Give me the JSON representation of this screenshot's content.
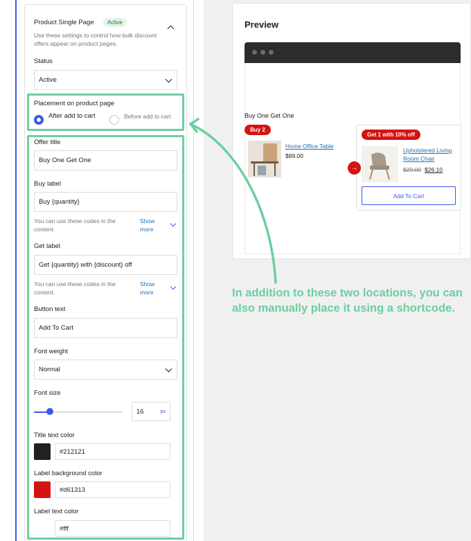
{
  "settings": {
    "section_title": "Product Single Page",
    "section_badge": "Active",
    "section_description": "Use these settings to control how bulk discount offers appear on product pages.",
    "status": {
      "label": "Status",
      "value": "Active"
    },
    "placement": {
      "label": "Placement on product page",
      "options": [
        {
          "label": "After add to cart",
          "selected": true
        },
        {
          "label": "Before add to cart",
          "selected": false
        }
      ]
    },
    "offer_title": {
      "label": "Offer title",
      "value": "Buy One Get One"
    },
    "buy_label": {
      "label": "Buy label",
      "value": "Buy {quantity}"
    },
    "buy_help": "You can use these codes in the content.",
    "show_more": "Show more",
    "get_label": {
      "label": "Get label",
      "value": "Get {quantity} with {discount} off"
    },
    "get_help": "You can use these codes in the content.",
    "button_text": {
      "label": "Button text",
      "value": "Add To Cart"
    },
    "font_weight": {
      "label": "Font weight",
      "value": "Normal"
    },
    "font_size": {
      "label": "Font size",
      "value": "16",
      "unit": "px",
      "slider_fraction": 0.18
    },
    "title_text_color": {
      "label": "Title text color",
      "value": "#212121"
    },
    "label_bg_color": {
      "label": "Label background color",
      "value": "#d61313"
    },
    "label_text_color": {
      "label": "Label text color",
      "value": "#fff"
    }
  },
  "preview": {
    "title": "Preview",
    "offer_title": "Buy One Get One",
    "buy_badge": "Buy 2",
    "product1": {
      "name": "Home Office Table",
      "price": "$89.00"
    },
    "get_badge": "Get 1 with 10% off",
    "product2": {
      "name": "Upholstered Living Room Chair",
      "old_price": "$29.00",
      "new_price": "$26.10"
    },
    "cart_button": "Add To Cart"
  },
  "callout": "In addition to these two locations, you can also manually place it using a shortcode.",
  "colors": {
    "accent": "#3858e9",
    "highlight": "#6ccf9f",
    "label_bg": "#d61313",
    "title_text": "#212121"
  }
}
